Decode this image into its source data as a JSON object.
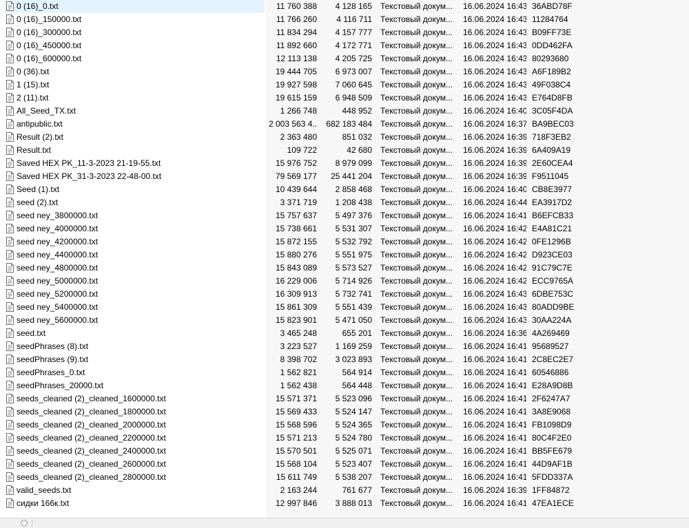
{
  "file_icon": "text-file-icon",
  "files": [
    {
      "name": "0 (16)_0.txt",
      "size": "11 760 388",
      "packed": "4 128 165",
      "type": "Текстовый докум...",
      "modified": "16.06.2024 16:43",
      "crc": "36ABD78F"
    },
    {
      "name": "0 (16)_150000.txt",
      "size": "11 766 260",
      "packed": "4 116 711",
      "type": "Текстовый докум...",
      "modified": "16.06.2024 16:43",
      "crc": "11284764"
    },
    {
      "name": "0 (16)_300000.txt",
      "size": "11 834 294",
      "packed": "4 157 777",
      "type": "Текстовый докум...",
      "modified": "16.06.2024 16:43",
      "crc": "B09FF73E"
    },
    {
      "name": "0 (16)_450000.txt",
      "size": "11 892 660",
      "packed": "4 172 771",
      "type": "Текстовый докум...",
      "modified": "16.06.2024 16:43",
      "crc": "0DD462FA"
    },
    {
      "name": "0 (16)_600000.txt",
      "size": "12 113 138",
      "packed": "4 205 725",
      "type": "Текстовый докум...",
      "modified": "16.06.2024 16:43",
      "crc": "80293680"
    },
    {
      "name": "0 (36).txt",
      "size": "19 444 705",
      "packed": "6 973 007",
      "type": "Текстовый докум...",
      "modified": "16.06.2024 16:43",
      "crc": "A6F189B2"
    },
    {
      "name": "1 (15).txt",
      "size": "19 927 598",
      "packed": "7 060 645",
      "type": "Текстовый докум...",
      "modified": "16.06.2024 16:43",
      "crc": "49F038C4"
    },
    {
      "name": "2 (11).txt",
      "size": "19 615 159",
      "packed": "6 948 509",
      "type": "Текстовый докум...",
      "modified": "16.06.2024 16:43",
      "crc": "E764D8FB"
    },
    {
      "name": "All_Seed_TX.txt",
      "size": "1 266 748",
      "packed": "448 952",
      "type": "Текстовый докум...",
      "modified": "16.06.2024 16:40",
      "crc": "3C05F4DA"
    },
    {
      "name": "antipublic.txt",
      "size": "2 003 563 4...",
      "packed": "682 183 484",
      "type": "Текстовый докум...",
      "modified": "16.06.2024 16:37",
      "crc": "BA9BEC03"
    },
    {
      "name": "Result (2).txt",
      "size": "2 363 480",
      "packed": "851 032",
      "type": "Текстовый докум...",
      "modified": "16.06.2024 16:39",
      "crc": "718F3EB2"
    },
    {
      "name": "Result.txt",
      "size": "109 722",
      "packed": "42 680",
      "type": "Текстовый докум...",
      "modified": "16.06.2024 16:39",
      "crc": "6A409A19"
    },
    {
      "name": "Saved HEX PK_11-3-2023 21-19-55.txt",
      "size": "15 976 752",
      "packed": "8 979 099",
      "type": "Текстовый докум...",
      "modified": "16.06.2024 16:39",
      "crc": "2E60CEA4"
    },
    {
      "name": "Saved HEX PK_31-3-2023 22-48-00.txt",
      "size": "79 569 177",
      "packed": "25 441 204",
      "type": "Текстовый докум...",
      "modified": "16.06.2024 16:39",
      "crc": "F9511045"
    },
    {
      "name": "Seed (1).txt",
      "size": "10 439 644",
      "packed": "2 858 468",
      "type": "Текстовый докум...",
      "modified": "16.06.2024 16:40",
      "crc": "CB8E3977"
    },
    {
      "name": "seed (2).txt",
      "size": "3 371 719",
      "packed": "1 208 438",
      "type": "Текстовый докум...",
      "modified": "16.06.2024 16:44",
      "crc": "EA3917D2"
    },
    {
      "name": "seed ney_3800000.txt",
      "size": "15 757 637",
      "packed": "5 497 376",
      "type": "Текстовый докум...",
      "modified": "16.06.2024 16:41",
      "crc": "B6EFCB33"
    },
    {
      "name": "seed ney_4000000.txt",
      "size": "15 738 661",
      "packed": "5 531 307",
      "type": "Текстовый докум...",
      "modified": "16.06.2024 16:42",
      "crc": "E4A81C21"
    },
    {
      "name": "seed ney_4200000.txt",
      "size": "15 872 155",
      "packed": "5 532 792",
      "type": "Текстовый докум...",
      "modified": "16.06.2024 16:42",
      "crc": "0FE1296B"
    },
    {
      "name": "seed ney_4400000.txt",
      "size": "15 880 276",
      "packed": "5 551 975",
      "type": "Текстовый докум...",
      "modified": "16.06.2024 16:42",
      "crc": "D923CE03"
    },
    {
      "name": "seed ney_4800000.txt",
      "size": "15 843 089",
      "packed": "5 573 527",
      "type": "Текстовый докум...",
      "modified": "16.06.2024 16:42",
      "crc": "91C79C7E"
    },
    {
      "name": "seed ney_5000000.txt",
      "size": "16 229 006",
      "packed": "5 714 926",
      "type": "Текстовый докум...",
      "modified": "16.06.2024 16:42",
      "crc": "ECC9765A"
    },
    {
      "name": "seed ney_5200000.txt",
      "size": "16 309 913",
      "packed": "5 732 741",
      "type": "Текстовый докум...",
      "modified": "16.06.2024 16:43",
      "crc": "6DBE753C"
    },
    {
      "name": "seed ney_5400000.txt",
      "size": "15 861 309",
      "packed": "5 551 439",
      "type": "Текстовый докум...",
      "modified": "16.06.2024 16:43",
      "crc": "80ADD9BE"
    },
    {
      "name": "seed ney_5600000.txt",
      "size": "15 823 901",
      "packed": "5 471 050",
      "type": "Текстовый докум...",
      "modified": "16.06.2024 16:43",
      "crc": "30AA224A"
    },
    {
      "name": "seed.txt",
      "size": "3 465 248",
      "packed": "655 201",
      "type": "Текстовый докум...",
      "modified": "16.06.2024 16:36",
      "crc": "4A269469"
    },
    {
      "name": "seedPhrases (8).txt",
      "size": "3 223 527",
      "packed": "1 169 259",
      "type": "Текстовый докум...",
      "modified": "16.06.2024 16:41",
      "crc": "95689527"
    },
    {
      "name": "seedPhrases (9).txt",
      "size": "8 398 702",
      "packed": "3 023 893",
      "type": "Текстовый докум...",
      "modified": "16.06.2024 16:41",
      "crc": "2C8EC2E7"
    },
    {
      "name": "seedPhrases_0.txt",
      "size": "1 562 821",
      "packed": "564 914",
      "type": "Текстовый докум...",
      "modified": "16.06.2024 16:41",
      "crc": "60546886"
    },
    {
      "name": "seedPhrases_20000.txt",
      "size": "1 562 438",
      "packed": "564 448",
      "type": "Текстовый докум...",
      "modified": "16.06.2024 16:41",
      "crc": "E28A9D8B"
    },
    {
      "name": "seeds_cleaned (2)_cleaned_1600000.txt",
      "size": "15 571 371",
      "packed": "5 523 096",
      "type": "Текстовый докум...",
      "modified": "16.06.2024 16:41",
      "crc": "2F6247A7"
    },
    {
      "name": "seeds_cleaned (2)_cleaned_1800000.txt",
      "size": "15 569 433",
      "packed": "5 524 147",
      "type": "Текстовый докум...",
      "modified": "16.06.2024 16:41",
      "crc": "3A8E9068"
    },
    {
      "name": "seeds_cleaned (2)_cleaned_2000000.txt",
      "size": "15 568 596",
      "packed": "5 524 365",
      "type": "Текстовый докум...",
      "modified": "16.06.2024 16:41",
      "crc": "FB1098D9"
    },
    {
      "name": "seeds_cleaned (2)_cleaned_2200000.txt",
      "size": "15 571 213",
      "packed": "5 524 780",
      "type": "Текстовый докум...",
      "modified": "16.06.2024 16:41",
      "crc": "80C4F2E0"
    },
    {
      "name": "seeds_cleaned (2)_cleaned_2400000.txt",
      "size": "15 570 501",
      "packed": "5 525 071",
      "type": "Текстовый докум...",
      "modified": "16.06.2024 16:41",
      "crc": "BB5FE679"
    },
    {
      "name": "seeds_cleaned (2)_cleaned_2600000.txt",
      "size": "15 568 104",
      "packed": "5 523 407",
      "type": "Текстовый докум...",
      "modified": "16.06.2024 16:41",
      "crc": "44D9AF1B"
    },
    {
      "name": "seeds_cleaned (2)_cleaned_2800000.txt",
      "size": "15 611 749",
      "packed": "5 538 207",
      "type": "Текстовый докум...",
      "modified": "16.06.2024 16:41",
      "crc": "5FDD337A"
    },
    {
      "name": "valid_seeds.txt",
      "size": "2 163 244",
      "packed": "761 677",
      "type": "Текстовый докум...",
      "modified": "16.06.2024 16:39",
      "crc": "1FF84872"
    },
    {
      "name": "сидки 166к.txt",
      "size": "12 997 846",
      "packed": "3 888 013",
      "type": "Текстовый докум...",
      "modified": "16.06.2024 16:41",
      "crc": "47EA1ECE"
    }
  ]
}
